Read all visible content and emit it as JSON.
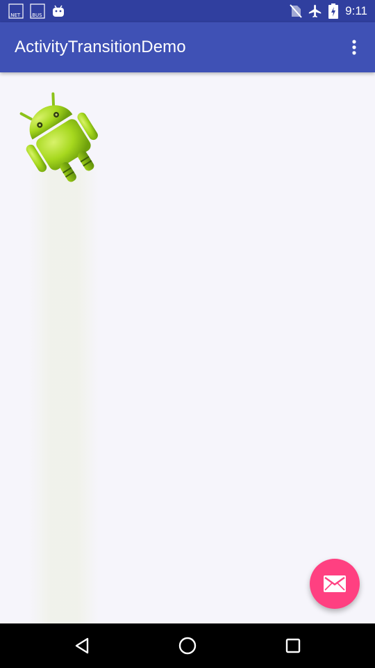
{
  "status_bar": {
    "time": "9:11",
    "notifications": [
      {
        "label": ".NET",
        "icon": "net-icon"
      },
      {
        "label": ".BUS",
        "icon": "bus-icon"
      },
      {
        "label": "",
        "icon": "android-notification-icon"
      }
    ],
    "system_icons": [
      "no-sim-icon",
      "airplane-mode-icon",
      "battery-charging-icon"
    ]
  },
  "app_bar": {
    "title": "ActivityTransitionDemo",
    "menu_icon": "overflow-menu-icon",
    "color": "#3f51b5"
  },
  "content": {
    "image_icon": "android-robot-icon",
    "background": "#f6f5fb"
  },
  "fab": {
    "icon": "email-icon",
    "color": "#ff4081"
  },
  "nav_bar": {
    "buttons": [
      "back-icon",
      "home-icon",
      "recents-icon"
    ]
  }
}
